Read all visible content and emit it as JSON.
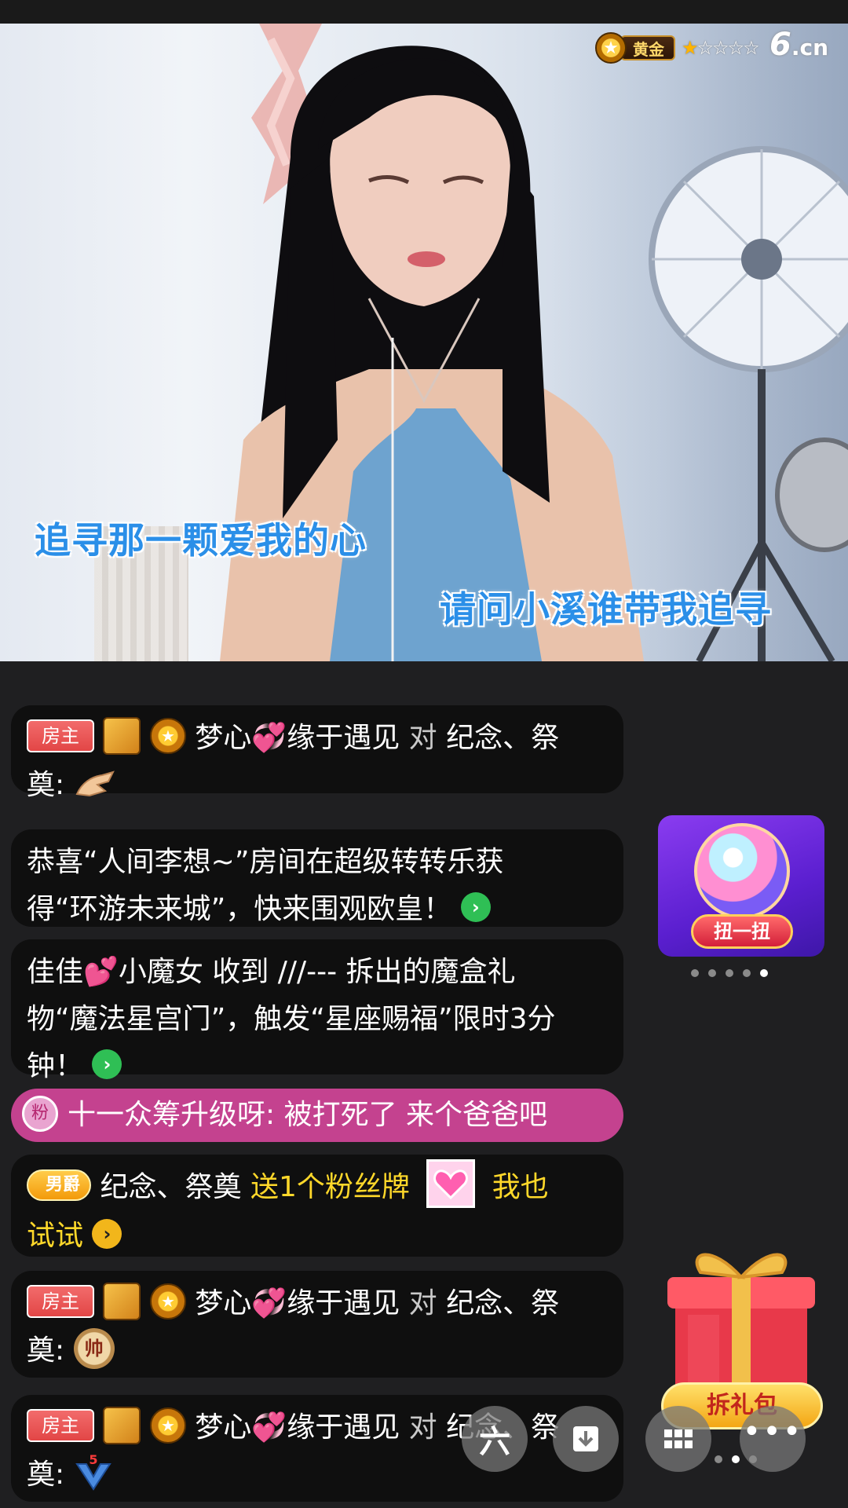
{
  "video": {
    "lyric_line_1": "追寻那一颗爱我的心",
    "lyric_line_2": "请问小溪谁带我追寻",
    "rank_label": "黄金",
    "rank_stars": 1,
    "rank_stars_total": 5,
    "logo_text": "6",
    "logo_suffix": ".cn"
  },
  "chat": {
    "messages": [
      {
        "tag": "房主",
        "user": "梦心",
        "user_suffix": "缘于遇见",
        "verb": "对",
        "target": "纪念、祭",
        "target_2": "奠:",
        "emoji": "pinch-hand-emoji"
      },
      {
        "line_1": "恭喜“人间李想~”房间在超级转转乐获",
        "line_2": "得“环游未来城”，快来围观欧皇！",
        "action": "go"
      },
      {
        "line_1_a": "佳佳",
        "line_1_b": "小魔女",
        "line_1_c": "收到 ///--- 拆出的魔盒礼",
        "line_2": "物“魔法星宫门”，触发“星座赐福”限时3分",
        "line_3": "钟！"
      },
      {
        "fan_badge": "粉",
        "text": "十一众筹升级呀: 被打死了 来个爸爸吧"
      },
      {
        "title_badge": "男爵",
        "user": "纪念、祭奠",
        "send_text": "送1个粉丝牌",
        "tail": "我也",
        "line_2": "试试"
      },
      {
        "tag": "房主",
        "user": "梦心",
        "user_suffix": "缘于遇见",
        "verb": "对",
        "target": "纪念、祭",
        "target_2": "奠:",
        "emoji_text": "帅"
      },
      {
        "tag": "房主",
        "user": "梦心",
        "user_suffix": "缘于遇见",
        "verb": "对",
        "target": "纪念、祭",
        "target_2": "奠:",
        "emoji_text": "5"
      }
    ]
  },
  "widgets": {
    "spin_button": "扭一扭",
    "gift_label": "拆礼包",
    "carousel_dots": 5,
    "carousel_active": 5
  },
  "toolbar": {
    "six_label": "六",
    "more_label": "•••"
  },
  "colors": {
    "host_tag": "#e24646",
    "highlight_yellow": "#ffd82a",
    "fan_bar_pink": "#c4428f",
    "lyric_blue": "#2b8fe8"
  }
}
